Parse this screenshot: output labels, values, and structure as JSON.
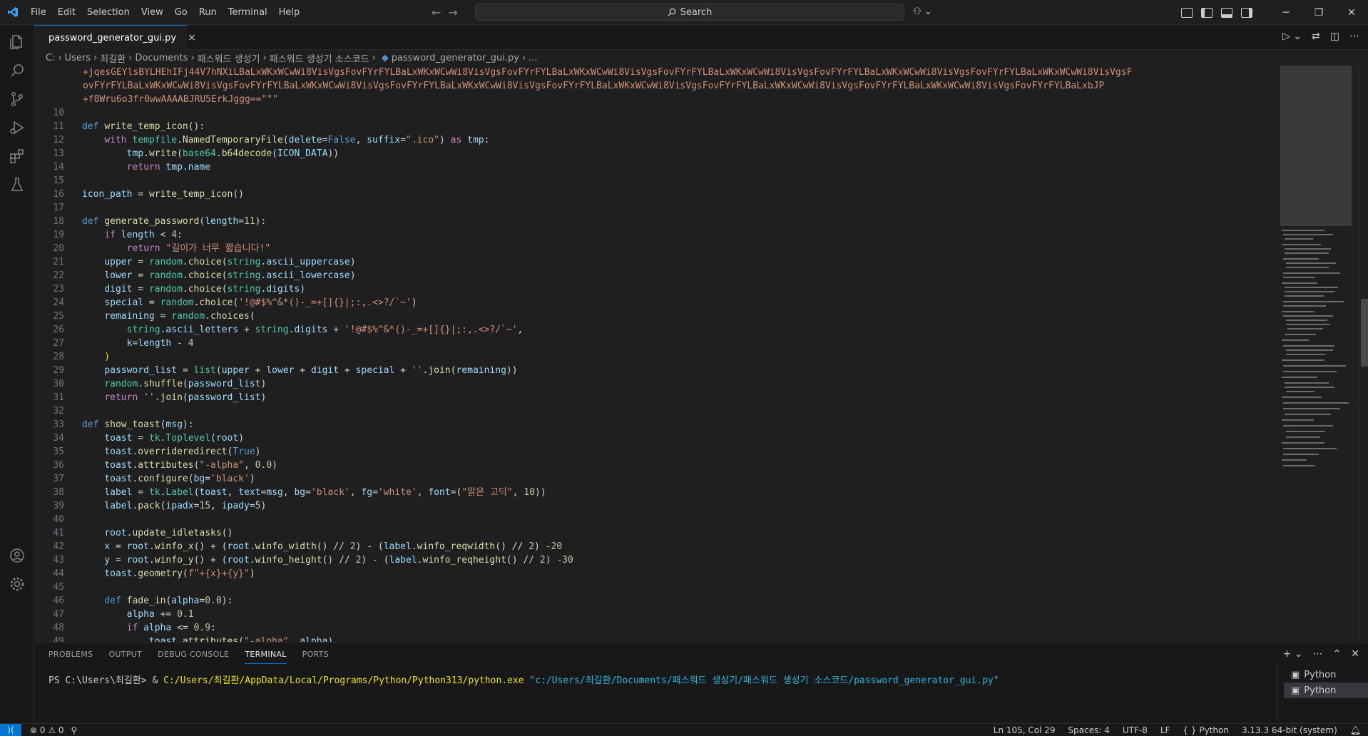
{
  "menu": [
    "File",
    "Edit",
    "Selection",
    "View",
    "Go",
    "Run",
    "Terminal",
    "Help"
  ],
  "search": {
    "placeholder": "Search"
  },
  "tab": {
    "label": "password_generator_gui.py",
    "close": "×"
  },
  "breadcrumb": [
    "C:",
    "Users",
    "최길환",
    "Documents",
    "패스워드 생성기",
    "패스워드 생성기 소스코드",
    "password_generator_gui.py",
    "..."
  ],
  "code": {
    "wrap1": "+jqesGEYlsBYLHEhIFj44V7hNXiLBaLxWKxWCwWi8VisVgsFovFYrFYLBaLxWKxWCwWi8VisVgsFovFYrFYLBaLxWKxWCwWi8VisVgsFovFYrFYLBaLxWKxWCwWi8VisVgsFovFYrFYLBaLxWKxWCwWi8VisVgsFovFYrFYLBaLxWKxWCwWi8VisVgsF",
    "wrap2": "ovFYrFYLBaLxWKxWCwWi8VisVgsFovFYrFYLBaLxWKxWCwWi8VisVgsFovFYrFYLBaLxWKxWCwWi8VisVgsFovFYrFYLBaLxWKxWCwWi8VisVgsFovFYrFYLBaLxWKxWCwWi8VisVgsFovFYrFYLBaLxWKxWCwWi8VisVgsFovFYrFYLBaLxbJP",
    "wrap3": "+f8Wru6o3fr0wwAAAABJRU5ErkJggg==\"\"\"",
    "l11_name": "write_temp_icon",
    "l12_fn": "tempfile",
    "l12_method": "NamedTemporaryFile",
    "l12_arg1": "delete",
    "l12_val1": "False",
    "l12_arg2": "suffix",
    "l12_str": "\".ico\"",
    "l12_as": "tmp",
    "l13_obj": "tmp",
    "l13_method": "write",
    "l13_mod": "base64",
    "l13_fn": "b64decode",
    "l13_const": "ICON_DATA",
    "l14_ret": "tmp.name",
    "l16_var": "icon_path",
    "l16_fn": "write_temp_icon",
    "l18_name": "generate_password",
    "l18_param": "length",
    "l18_default": "11",
    "l19_var": "length",
    "l19_num": "4",
    "l20_str": "\"길이가 너무 짧습니다!\"",
    "l21_var": "upper",
    "l21_attr": "ascii_uppercase",
    "l22_var": "lower",
    "l22_attr": "ascii_lowercase",
    "l23_var": "digit",
    "l23_attr": "digits",
    "l24_var": "special",
    "l24_str": "'!@#$%^&*()-_=+[]{}|;:,.<>?/`~'",
    "l25_var": "remaining",
    "l25_fn": "choices",
    "l26_str": "'!@#$%^&*()-_=+[]{}|;:,.<>?/`~'",
    "l27_k": "k",
    "l27_len": "length",
    "l27_num": "4",
    "l29_var": "password_list",
    "l29_str": "''",
    "l32_empty": "",
    "l33_name": "show_toast",
    "l33_param": "msg",
    "l34_var": "toast",
    "l34_cls": "Toplevel",
    "l35_method": "overrideredirect",
    "l35_val": "True",
    "l36_method": "attributes",
    "l36_str": "\"-alpha\"",
    "l36_num": "0.0",
    "l37_method": "configure",
    "l37_str": "'black'",
    "l38_cls": "Label",
    "l38_str_fg": "'white'",
    "l38_font": "\"맑은 고딕\"",
    "l38_size": "10",
    "l39_padx": "15",
    "l39_pady": "5",
    "l42_off": "-20",
    "l43_off": "-30",
    "l44_fstr": "f\"+{x}+{y}\"",
    "l46_name": "fade_in",
    "l46_default": "0.0",
    "l47_num": "0.1",
    "l48_num": "0.9",
    "l49_str": "\"-alpha\""
  },
  "line_numbers": [
    "10",
    "11",
    "12",
    "13",
    "14",
    "15",
    "16",
    "17",
    "18",
    "19",
    "20",
    "21",
    "22",
    "23",
    "24",
    "25",
    "26",
    "27",
    "28",
    "29",
    "30",
    "31",
    "32",
    "33",
    "34",
    "35",
    "36",
    "37",
    "38",
    "39",
    "40",
    "41",
    "42",
    "43",
    "44",
    "45",
    "46",
    "47",
    "48",
    "49"
  ],
  "panel": {
    "tabs": [
      "PROBLEMS",
      "OUTPUT",
      "DEBUG CONSOLE",
      "TERMINAL",
      "PORTS"
    ],
    "prompt": "PS C:\\Users\\최길환> & ",
    "exe": "C:/Users/최길환/AppData/Local/Programs/Python/Python313/python.exe",
    "script": "\"c:/Users/최길환/Documents/패스워드 생성기/패스워드 생성기 소스코드/password_generator_gui.py\"",
    "terminals": [
      "Python",
      "Python"
    ]
  },
  "status": {
    "errors": "0",
    "warnings": "0",
    "position": "Ln 105, Col 29",
    "spaces": "Spaces: 4",
    "encoding": "UTF-8",
    "eol": "LF",
    "language": "Python",
    "interpreter": "3.13.3 64-bit (system)"
  },
  "colors": {
    "accent": "#0078d4",
    "editor_bg": "#1f1f1f",
    "sidebar_bg": "#181818"
  }
}
